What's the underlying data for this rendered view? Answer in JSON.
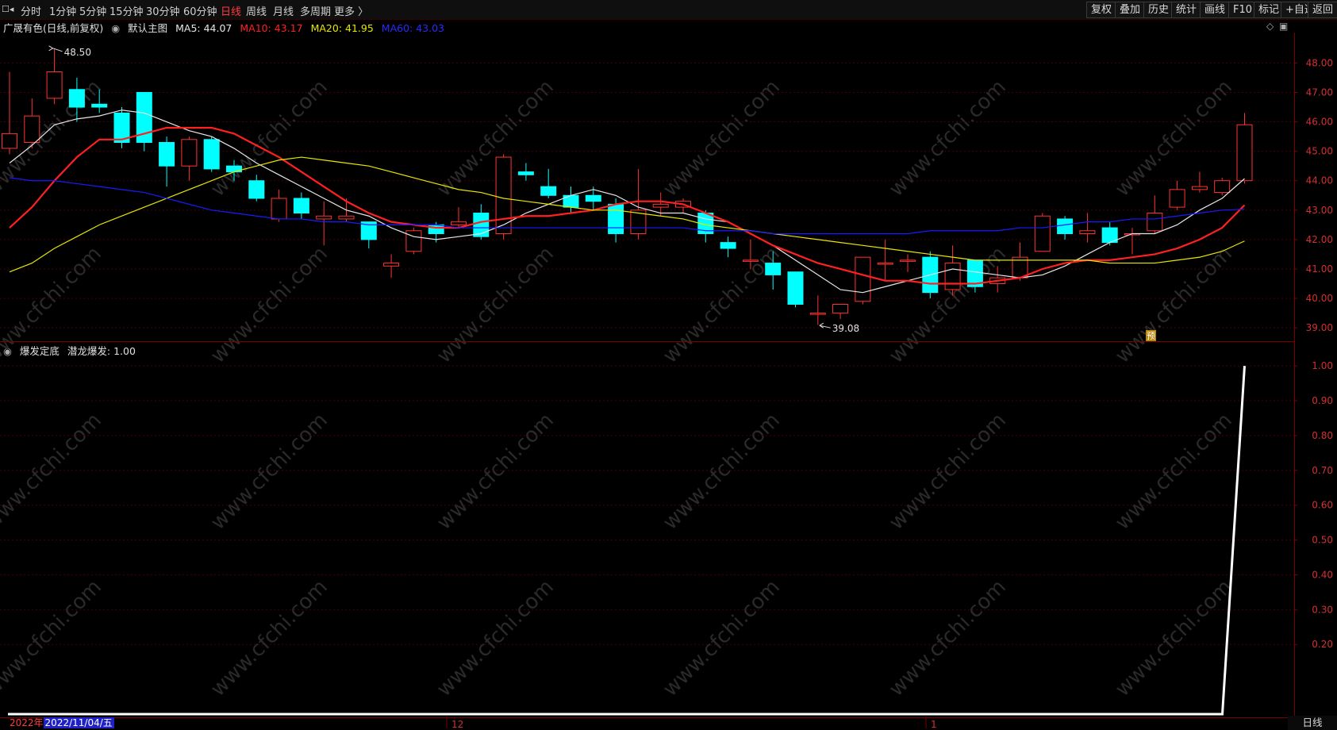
{
  "toolbar": {
    "left_icon": "collapse-icon",
    "left_items": [
      "分时",
      "1分钟",
      "5分钟",
      "15分钟",
      "30分钟",
      "60分钟",
      "日线",
      "周线",
      "月线",
      "多周期",
      "更多 〉"
    ],
    "active": "日线",
    "right_items": [
      "复权",
      "叠加",
      "历史",
      "统计",
      "画线",
      "F10",
      "标记",
      "+自选",
      "返回"
    ]
  },
  "main_header": {
    "stock": "广晟有色(日线,前复权)",
    "template": "默认主图",
    "ma5": "MA5: 44.07",
    "ma10": "MA10: 43.17",
    "ma20": "MA20: 41.95",
    "ma60": "MA60: 43.03"
  },
  "indicator_header": {
    "name": "爆发定底",
    "series": "潜龙爆发: 1.00"
  },
  "annotations": {
    "high": "48.50",
    "low": "39.08",
    "pre_marker": "预"
  },
  "x_axis": {
    "year_label": "2022年",
    "cursor_date": "2022/11/04/五",
    "month_labels": [
      "12",
      "1"
    ]
  },
  "status": {
    "period": "日线"
  },
  "watermark": "www.cfchi.com",
  "colors": {
    "up": "#ff3232",
    "down": "#00ffff",
    "ma5": "#e6e6e6",
    "ma10": "#ff2020",
    "ma20": "#e6e600",
    "ma60": "#1a1aff",
    "indicator": "#ffffff",
    "frame": "#7a0000",
    "grid": "#4a0000"
  },
  "chart_data": [
    {
      "type": "candlestick",
      "title": "广晟有色(日线,前复权)",
      "y_ticks": [
        39.0,
        40.0,
        41.0,
        42.0,
        43.0,
        44.0,
        45.0,
        46.0,
        47.0,
        48.0
      ],
      "ylim": [
        38.6,
        48.9
      ],
      "grid": true,
      "candles": [
        {
          "o": 45.1,
          "h": 47.7,
          "l": 44.9,
          "c": 45.6
        },
        {
          "o": 45.3,
          "h": 46.8,
          "l": 45.1,
          "c": 46.2
        },
        {
          "o": 46.8,
          "h": 48.5,
          "l": 46.6,
          "c": 47.7
        },
        {
          "o": 47.1,
          "h": 47.5,
          "l": 46.0,
          "c": 46.5
        },
        {
          "o": 46.6,
          "h": 47.1,
          "l": 46.3,
          "c": 46.5
        },
        {
          "o": 46.3,
          "h": 46.5,
          "l": 45.1,
          "c": 45.3
        },
        {
          "o": 47.0,
          "h": 47.0,
          "l": 45.0,
          "c": 45.3
        },
        {
          "o": 45.3,
          "h": 45.5,
          "l": 43.8,
          "c": 44.5
        },
        {
          "o": 44.5,
          "h": 45.5,
          "l": 44.0,
          "c": 45.4
        },
        {
          "o": 45.4,
          "h": 45.5,
          "l": 44.3,
          "c": 44.4
        },
        {
          "o": 44.5,
          "h": 44.7,
          "l": 44.0,
          "c": 44.3
        },
        {
          "o": 44.0,
          "h": 44.2,
          "l": 43.3,
          "c": 43.4
        },
        {
          "o": 42.7,
          "h": 43.7,
          "l": 42.6,
          "c": 43.4
        },
        {
          "o": 43.4,
          "h": 43.6,
          "l": 42.7,
          "c": 42.9
        },
        {
          "o": 42.7,
          "h": 43.3,
          "l": 41.8,
          "c": 42.8
        },
        {
          "o": 42.7,
          "h": 43.4,
          "l": 42.6,
          "c": 42.8
        },
        {
          "o": 42.6,
          "h": 42.6,
          "l": 41.7,
          "c": 42.0
        },
        {
          "o": 41.1,
          "h": 41.5,
          "l": 40.7,
          "c": 41.2
        },
        {
          "o": 41.6,
          "h": 42.4,
          "l": 41.5,
          "c": 42.3
        },
        {
          "o": 42.5,
          "h": 42.6,
          "l": 41.9,
          "c": 42.2
        },
        {
          "o": 42.5,
          "h": 43.1,
          "l": 42.4,
          "c": 42.6
        },
        {
          "o": 42.9,
          "h": 43.2,
          "l": 42.0,
          "c": 42.1
        },
        {
          "o": 42.2,
          "h": 44.9,
          "l": 42.0,
          "c": 44.8
        },
        {
          "o": 44.3,
          "h": 44.6,
          "l": 44.0,
          "c": 44.2
        },
        {
          "o": 43.8,
          "h": 44.4,
          "l": 43.4,
          "c": 43.5
        },
        {
          "o": 43.5,
          "h": 43.8,
          "l": 42.9,
          "c": 43.1
        },
        {
          "o": 43.5,
          "h": 43.8,
          "l": 43.0,
          "c": 43.3
        },
        {
          "o": 43.2,
          "h": 43.4,
          "l": 41.9,
          "c": 42.2
        },
        {
          "o": 42.2,
          "h": 44.4,
          "l": 42.0,
          "c": 43.0
        },
        {
          "o": 43.1,
          "h": 43.6,
          "l": 42.8,
          "c": 43.2
        },
        {
          "o": 43.1,
          "h": 43.4,
          "l": 42.9,
          "c": 43.3
        },
        {
          "o": 42.9,
          "h": 43.0,
          "l": 41.9,
          "c": 42.2
        },
        {
          "o": 41.9,
          "h": 42.1,
          "l": 41.4,
          "c": 41.7
        },
        {
          "o": 41.3,
          "h": 42.0,
          "l": 41.0,
          "c": 41.3
        },
        {
          "o": 41.2,
          "h": 41.6,
          "l": 40.3,
          "c": 40.8
        },
        {
          "o": 40.9,
          "h": 40.9,
          "l": 39.7,
          "c": 39.8
        },
        {
          "o": 39.5,
          "h": 40.1,
          "l": 39.1,
          "c": 39.5
        },
        {
          "o": 39.5,
          "h": 39.8,
          "l": 39.3,
          "c": 39.8
        },
        {
          "o": 39.9,
          "h": 41.4,
          "l": 39.8,
          "c": 41.4
        },
        {
          "o": 41.2,
          "h": 42.0,
          "l": 40.6,
          "c": 41.2
        },
        {
          "o": 41.3,
          "h": 41.5,
          "l": 40.9,
          "c": 41.3
        },
        {
          "o": 41.4,
          "h": 41.6,
          "l": 40.0,
          "c": 40.2
        },
        {
          "o": 40.3,
          "h": 41.8,
          "l": 40.1,
          "c": 41.2
        },
        {
          "o": 41.3,
          "h": 41.3,
          "l": 40.2,
          "c": 40.4
        },
        {
          "o": 40.5,
          "h": 41.1,
          "l": 40.2,
          "c": 40.7
        },
        {
          "o": 40.7,
          "h": 41.9,
          "l": 40.6,
          "c": 41.4
        },
        {
          "o": 41.6,
          "h": 42.9,
          "l": 41.6,
          "c": 42.8
        },
        {
          "o": 42.7,
          "h": 42.8,
          "l": 42.0,
          "c": 42.2
        },
        {
          "o": 42.2,
          "h": 42.9,
          "l": 41.9,
          "c": 42.3
        },
        {
          "o": 42.4,
          "h": 42.6,
          "l": 41.8,
          "c": 41.9
        },
        {
          "o": 42.2,
          "h": 42.4,
          "l": 41.5,
          "c": 42.2
        },
        {
          "o": 42.3,
          "h": 43.5,
          "l": 42.2,
          "c": 42.9
        },
        {
          "o": 43.1,
          "h": 44.0,
          "l": 43.0,
          "c": 43.7
        },
        {
          "o": 43.7,
          "h": 44.3,
          "l": 43.6,
          "c": 43.8
        },
        {
          "o": 43.6,
          "h": 44.1,
          "l": 43.5,
          "c": 44.0
        },
        {
          "o": 44.0,
          "h": 46.3,
          "l": 43.9,
          "c": 45.9
        }
      ],
      "series": [
        {
          "name": "MA5",
          "values": [
            44.6,
            45.2,
            45.9,
            46.1,
            46.2,
            46.4,
            46.3,
            46.0,
            45.7,
            45.5,
            45.1,
            44.6,
            44.2,
            43.8,
            43.4,
            43.0,
            42.8,
            42.4,
            42.1,
            42.0,
            42.1,
            42.2,
            42.5,
            42.9,
            43.2,
            43.5,
            43.7,
            43.5,
            43.1,
            42.9,
            42.9,
            42.7,
            42.6,
            42.2,
            41.8,
            41.3,
            40.8,
            40.3,
            40.2,
            40.4,
            40.6,
            40.8,
            41.0,
            40.9,
            40.8,
            40.7,
            40.8,
            41.1,
            41.5,
            41.9,
            42.2,
            42.2,
            42.5,
            43.0,
            43.4,
            44.07
          ]
        },
        {
          "name": "MA10",
          "values": [
            42.4,
            43.1,
            44.0,
            44.8,
            45.4,
            45.4,
            45.6,
            45.8,
            45.8,
            45.8,
            45.6,
            45.2,
            44.8,
            44.3,
            43.8,
            43.3,
            42.9,
            42.6,
            42.5,
            42.4,
            42.4,
            42.6,
            42.7,
            42.8,
            42.8,
            42.9,
            43.0,
            43.2,
            43.3,
            43.3,
            43.2,
            42.9,
            42.6,
            42.2,
            41.8,
            41.5,
            41.2,
            41.0,
            40.8,
            40.6,
            40.6,
            40.5,
            40.5,
            40.5,
            40.6,
            40.7,
            41.0,
            41.2,
            41.3,
            41.3,
            41.4,
            41.5,
            41.7,
            42.0,
            42.4,
            43.17
          ]
        },
        {
          "name": "MA20",
          "values": [
            40.9,
            41.2,
            41.7,
            42.1,
            42.5,
            42.8,
            43.1,
            43.4,
            43.7,
            44.0,
            44.3,
            44.5,
            44.7,
            44.8,
            44.7,
            44.6,
            44.5,
            44.3,
            44.1,
            43.9,
            43.7,
            43.6,
            43.4,
            43.3,
            43.2,
            43.1,
            43.0,
            43.0,
            42.9,
            42.8,
            42.7,
            42.5,
            42.4,
            42.3,
            42.2,
            42.1,
            42.0,
            41.9,
            41.8,
            41.7,
            41.6,
            41.5,
            41.4,
            41.3,
            41.3,
            41.3,
            41.3,
            41.3,
            41.3,
            41.2,
            41.2,
            41.2,
            41.3,
            41.4,
            41.6,
            41.95
          ]
        },
        {
          "name": "MA60",
          "values": [
            44.1,
            44.0,
            44.0,
            43.9,
            43.8,
            43.7,
            43.6,
            43.4,
            43.2,
            43.0,
            42.9,
            42.8,
            42.7,
            42.7,
            42.6,
            42.6,
            42.5,
            42.5,
            42.5,
            42.5,
            42.4,
            42.4,
            42.4,
            42.4,
            42.4,
            42.4,
            42.4,
            42.4,
            42.4,
            42.4,
            42.4,
            42.3,
            42.3,
            42.3,
            42.2,
            42.2,
            42.2,
            42.2,
            42.2,
            42.2,
            42.2,
            42.3,
            42.3,
            42.3,
            42.3,
            42.4,
            42.4,
            42.5,
            42.6,
            42.6,
            42.7,
            42.7,
            42.8,
            42.9,
            43.0,
            43.03
          ]
        }
      ]
    },
    {
      "type": "line",
      "title": "爆发定底",
      "y_ticks": [
        0.2,
        0.3,
        0.4,
        0.5,
        0.6,
        0.7,
        0.8,
        0.9,
        1.0
      ],
      "ylim": [
        0.0,
        1.03
      ],
      "series": [
        {
          "name": "潜龙爆发",
          "values": [
            0,
            0,
            0,
            0,
            0,
            0,
            0,
            0,
            0,
            0,
            0,
            0,
            0,
            0,
            0,
            0,
            0,
            0,
            0,
            0,
            0,
            0,
            0,
            0,
            0,
            0,
            0,
            0,
            0,
            0,
            0,
            0,
            0,
            0,
            0,
            0,
            0,
            0,
            0,
            0,
            0,
            0,
            0,
            0,
            0,
            0,
            0,
            0,
            0,
            0,
            0,
            0,
            0,
            0,
            0,
            1.0
          ]
        }
      ]
    }
  ]
}
